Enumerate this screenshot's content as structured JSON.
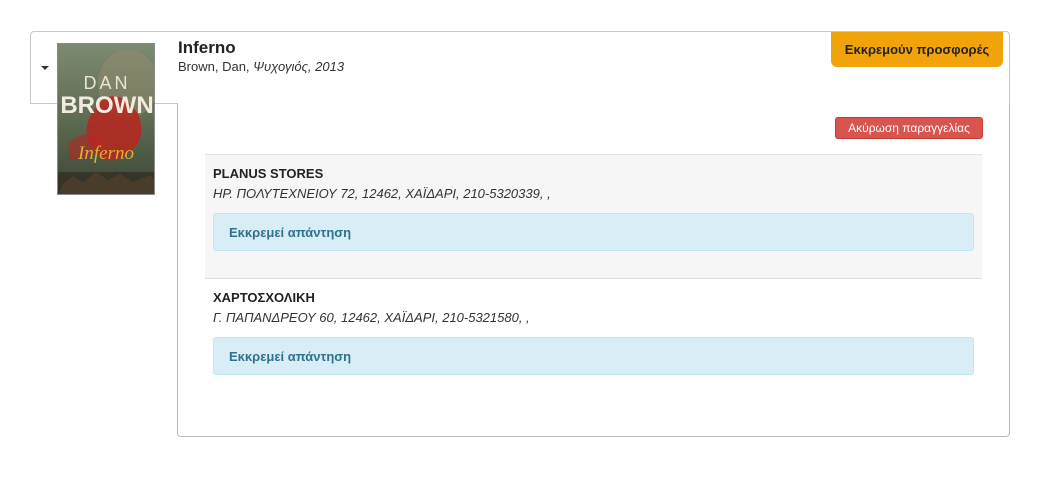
{
  "book": {
    "title": "Inferno",
    "author": "Brown, Dan,",
    "publisher_year": "Ψυχογιός, 2013",
    "cover": {
      "author_line1": "DAN",
      "author_line2": "BROWN",
      "title_text": "Inferno",
      "colors": {
        "background": "#6b7a5e",
        "red": "#b8261f",
        "gold": "#d9b23a"
      }
    }
  },
  "status_badge": "Εκκρεμούν προσφορές",
  "cancel_button": "Ακύρωση παραγγελίας",
  "stores": [
    {
      "name": "PLANUS STORES",
      "address": "ΗΡ. ΠΟΛΥΤΕΧΝΕΙΟΥ 72, 12462, ΧΑΪΔΑΡΙ, 210-5320339, ,",
      "status": "Εκκρεμεί απάντηση"
    },
    {
      "name": "ΧΑΡΤΟΣΧΟΛΙΚΗ",
      "address": "Γ. ΠΑΠΑΝΔΡΕΟΥ 60, 12462, ΧΑΪΔΑΡΙ, 210-5321580, ,",
      "status": "Εκκρεμεί απάντηση"
    }
  ],
  "colors": {
    "badge": "#f0a30a",
    "danger": "#d9534f",
    "info_bg": "#d9edf7",
    "info_text": "#31708f"
  }
}
